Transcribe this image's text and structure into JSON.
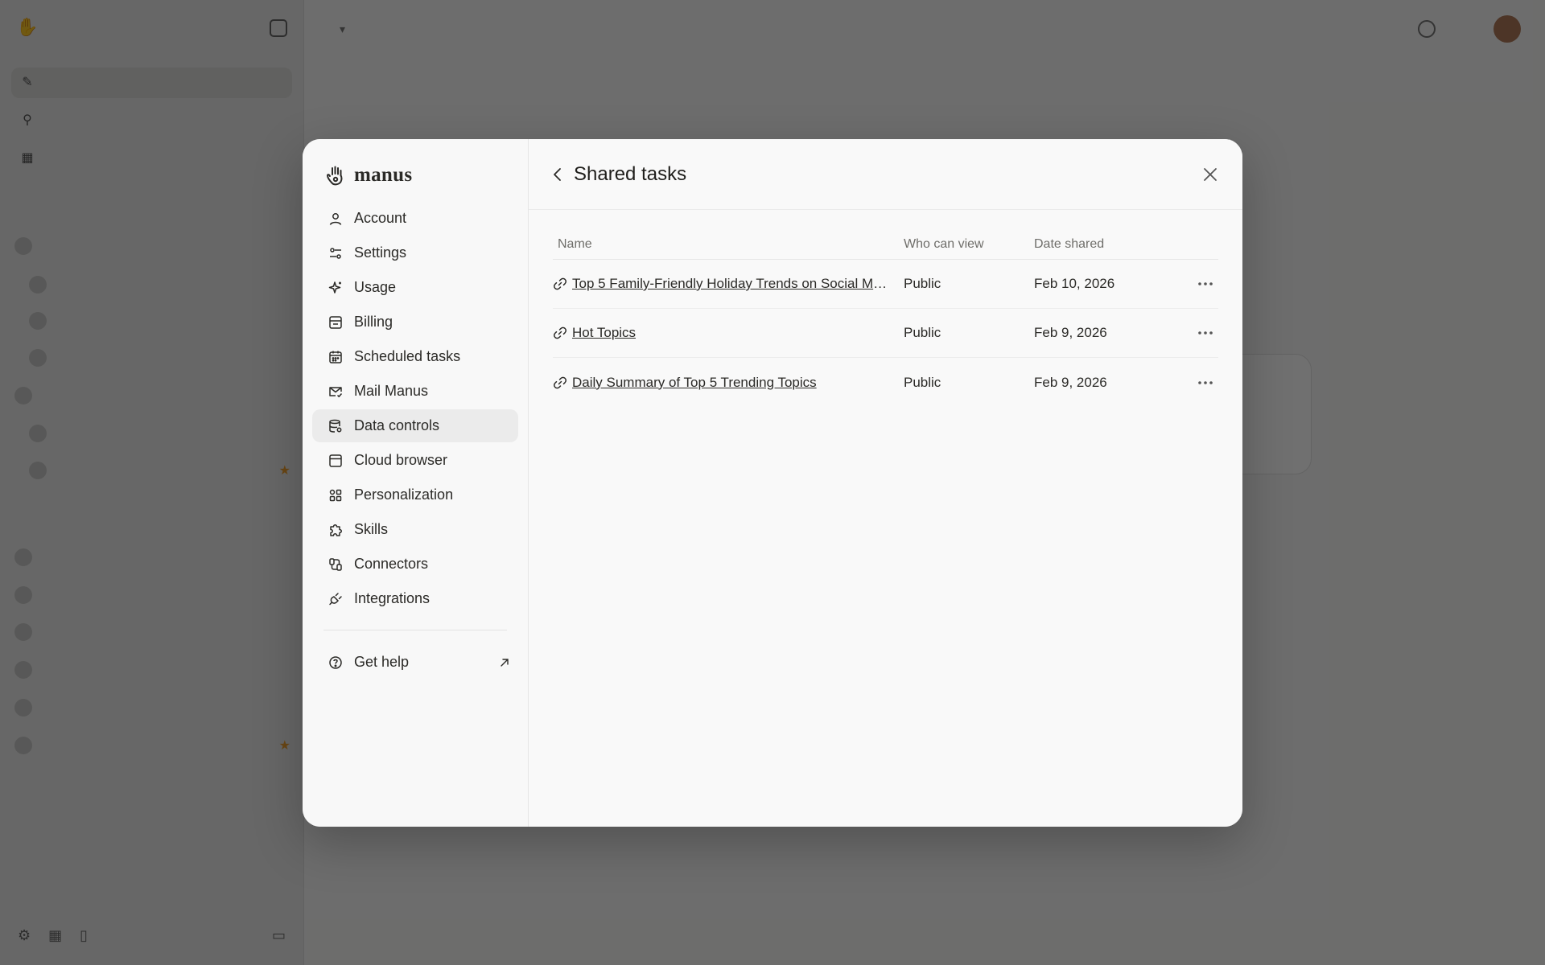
{
  "modal": {
    "brand": "manus",
    "menu": [
      {
        "label": "Account",
        "icon": "user-icon"
      },
      {
        "label": "Settings",
        "icon": "sliders-icon"
      },
      {
        "label": "Usage",
        "icon": "sparkle-icon"
      },
      {
        "label": "Billing",
        "icon": "billing-icon"
      },
      {
        "label": "Scheduled tasks",
        "icon": "calendar-icon"
      },
      {
        "label": "Mail Manus",
        "icon": "mail-icon"
      },
      {
        "label": "Data controls",
        "icon": "database-icon",
        "active": true
      },
      {
        "label": "Cloud browser",
        "icon": "browser-icon"
      },
      {
        "label": "Personalization",
        "icon": "grid-icon"
      },
      {
        "label": "Skills",
        "icon": "puzzle-icon"
      },
      {
        "label": "Connectors",
        "icon": "connector-icon"
      },
      {
        "label": "Integrations",
        "icon": "plug-icon"
      }
    ],
    "help_label": "Get help",
    "title": "Shared tasks",
    "table": {
      "headers": {
        "name": "Name",
        "who": "Who can view",
        "date": "Date shared"
      },
      "rows": [
        {
          "name": "Top 5 Family-Friendly Holiday Trends on Social Media",
          "who": "Public",
          "date": "Feb 10, 2026"
        },
        {
          "name": "Hot Topics",
          "who": "Public",
          "date": "Feb 9, 2026"
        },
        {
          "name": "Daily Summary of Top 5 Trending Topics",
          "who": "Public",
          "date": "Feb 9, 2026"
        }
      ]
    }
  },
  "colors": {
    "overlay": "#000000",
    "modal_bg": "#f8f8f8",
    "active_item": "#ebebeb",
    "text": "#2b2a27"
  }
}
